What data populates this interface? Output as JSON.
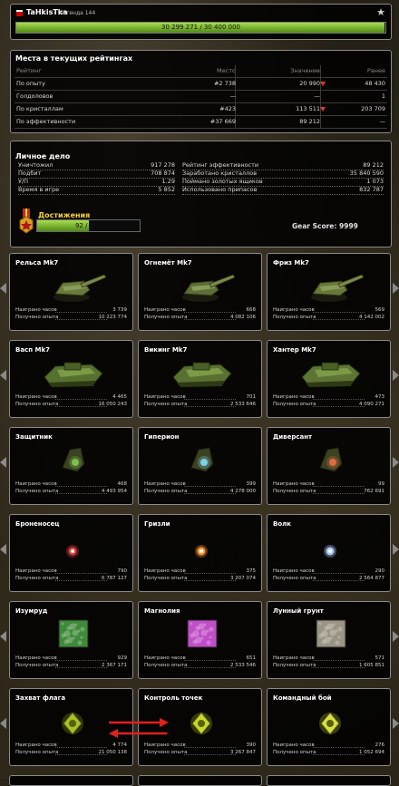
{
  "header": {
    "player_name": "TaHkisTka",
    "rank": "Легенда 144",
    "xp_text": "30 299 271 / 30 400 000",
    "xp_progress": 0.9967
  },
  "ratings": {
    "title": "Места в текущих рейтингах",
    "columns": [
      "Рейтинг",
      "Место",
      "Значение",
      "Ранее"
    ],
    "rows": [
      {
        "name": "По опыту",
        "place": "#2 738",
        "value": "20 990",
        "down": true,
        "prev": "48 430"
      },
      {
        "name": "Голдоловов",
        "place": "—",
        "value": "—",
        "down": false,
        "prev": "1"
      },
      {
        "name": "По кристаллам",
        "place": "#423",
        "value": "113 511",
        "down": true,
        "prev": "203 709"
      },
      {
        "name": "По эффективности",
        "place": "#37 669",
        "value": "89 212",
        "down": false,
        "prev": "—"
      }
    ]
  },
  "personal": {
    "title": "Личное дело",
    "left": [
      {
        "label": "Уничтожил",
        "value": "917 278"
      },
      {
        "label": "Подбит",
        "value": "708 874"
      },
      {
        "label": "У/П",
        "value": "1.29"
      },
      {
        "label": "Время в игре",
        "value": "5 852"
      }
    ],
    "right": [
      {
        "label": "Рейтинг эффективности",
        "value": "89 212"
      },
      {
        "label": "Заработано кристаллов",
        "value": "35 840 590"
      },
      {
        "label": "Поймано золотых ящиков",
        "value": "1 073"
      },
      {
        "label": "Использовано припасов",
        "value": "832 787"
      }
    ],
    "achievements_label": "Достижения",
    "achievements_text": "92 / 182",
    "achievements_progress": 0.505,
    "gear_score": "Gear Score: 9999"
  },
  "stat_labels": {
    "hours": "Наиграно часов",
    "exp": "Получено опыта"
  },
  "cards": [
    {
      "title": "Рельса Mk7",
      "hours": "3 739",
      "exp": "10 223 774",
      "kind": "turret",
      "color": "#6a7a3a"
    },
    {
      "title": "Огнемёт Mk7",
      "hours": "668",
      "exp": "4 082 106",
      "kind": "turret",
      "color": "#5c6e38"
    },
    {
      "title": "Фриз Mk7",
      "hours": "569",
      "exp": "4 142 002",
      "kind": "turret",
      "color": "#687838"
    },
    {
      "title": "Васп Mk7",
      "hours": "4 465",
      "exp": "16 050 243",
      "kind": "hull",
      "color": "#56702e"
    },
    {
      "title": "Викинг Mk7",
      "hours": "701",
      "exp": "2 533 646",
      "kind": "hull",
      "color": "#5a7030"
    },
    {
      "title": "Хантер Mk7",
      "hours": "473",
      "exp": "4 090 271",
      "kind": "hull",
      "color": "#5e7434"
    },
    {
      "title": "Защитник",
      "hours": "468",
      "exp": "4 493 954",
      "kind": "drone",
      "color": "#7fc04a"
    },
    {
      "title": "Гиперион",
      "hours": "399",
      "exp": "4 278 000",
      "kind": "drone",
      "color": "#7ad0e8"
    },
    {
      "title": "Диверсант",
      "hours": "99",
      "exp": "762 691",
      "kind": "drone",
      "color": "#e06a40"
    },
    {
      "title": "Броненосец",
      "hours": "790",
      "exp": "6 787 127",
      "kind": "orb",
      "color": "#e04040"
    },
    {
      "title": "Гризли",
      "hours": "375",
      "exp": "3 207 074",
      "kind": "orb",
      "color": "#ff9a30"
    },
    {
      "title": "Волк",
      "hours": "290",
      "exp": "2 564 877",
      "kind": "orb",
      "color": "#a8c8ff"
    },
    {
      "title": "Изумруд",
      "hours": "929",
      "exp": "2 367 171",
      "kind": "paint",
      "color": "#3f8a3a"
    },
    {
      "title": "Магнолия",
      "hours": "651",
      "exp": "2 533 546",
      "kind": "paint",
      "color": "#c04ec8"
    },
    {
      "title": "Лунный грунт",
      "hours": "571",
      "exp": "1 605 851",
      "kind": "paint",
      "color": "#9a9484"
    },
    {
      "title": "Захват флага",
      "hours": "4 774",
      "exp": "21 050 138",
      "kind": "mode",
      "color": "#a8c028"
    },
    {
      "title": "Контроль точек",
      "hours": "390",
      "exp": "3 267 847",
      "kind": "mode",
      "color": "#c8d828"
    },
    {
      "title": "Командный бой",
      "hours": "276",
      "exp": "1 052 694",
      "kind": "mode",
      "color": "#d8e040"
    }
  ]
}
